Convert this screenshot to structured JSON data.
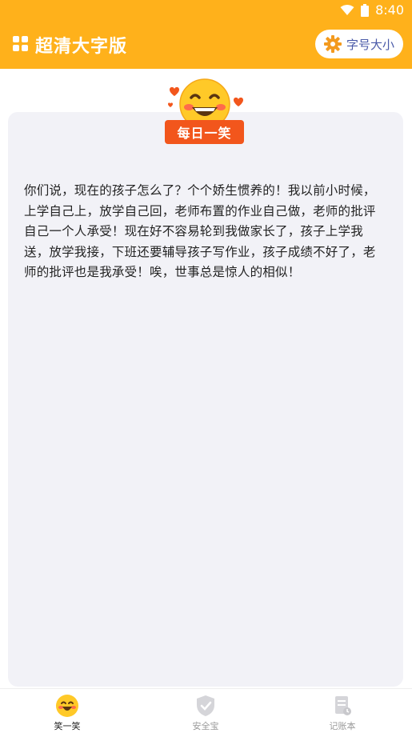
{
  "status_bar": {
    "time": "8:40"
  },
  "app_bar": {
    "title": "超清大字版",
    "font_size_button": "字号大小"
  },
  "card": {
    "badge": "每日一笑",
    "text": "你们说，现在的孩子怎么了？个个娇生惯养的！我以前小时候，上学自己上，放学自己回，老师布置的作业自己做，老师的批评自己一个人承受！现在好不容易轮到我做家长了，孩子上学我送，放学我接，下班还要辅导孩子写作业，孩子成绩不好了，老师的批评也是我承受！唉，世事总是惊人的相似！"
  },
  "bottom_nav": {
    "items": [
      {
        "label": "笑一笑",
        "icon": "smiley-icon",
        "active": true
      },
      {
        "label": "安全宝",
        "icon": "shield-icon",
        "active": false
      },
      {
        "label": "记账本",
        "icon": "ledger-icon",
        "active": false
      }
    ]
  },
  "colors": {
    "primary": "#FFB11B",
    "badge": "#F2561C",
    "card_bg": "#F2F2F7"
  }
}
